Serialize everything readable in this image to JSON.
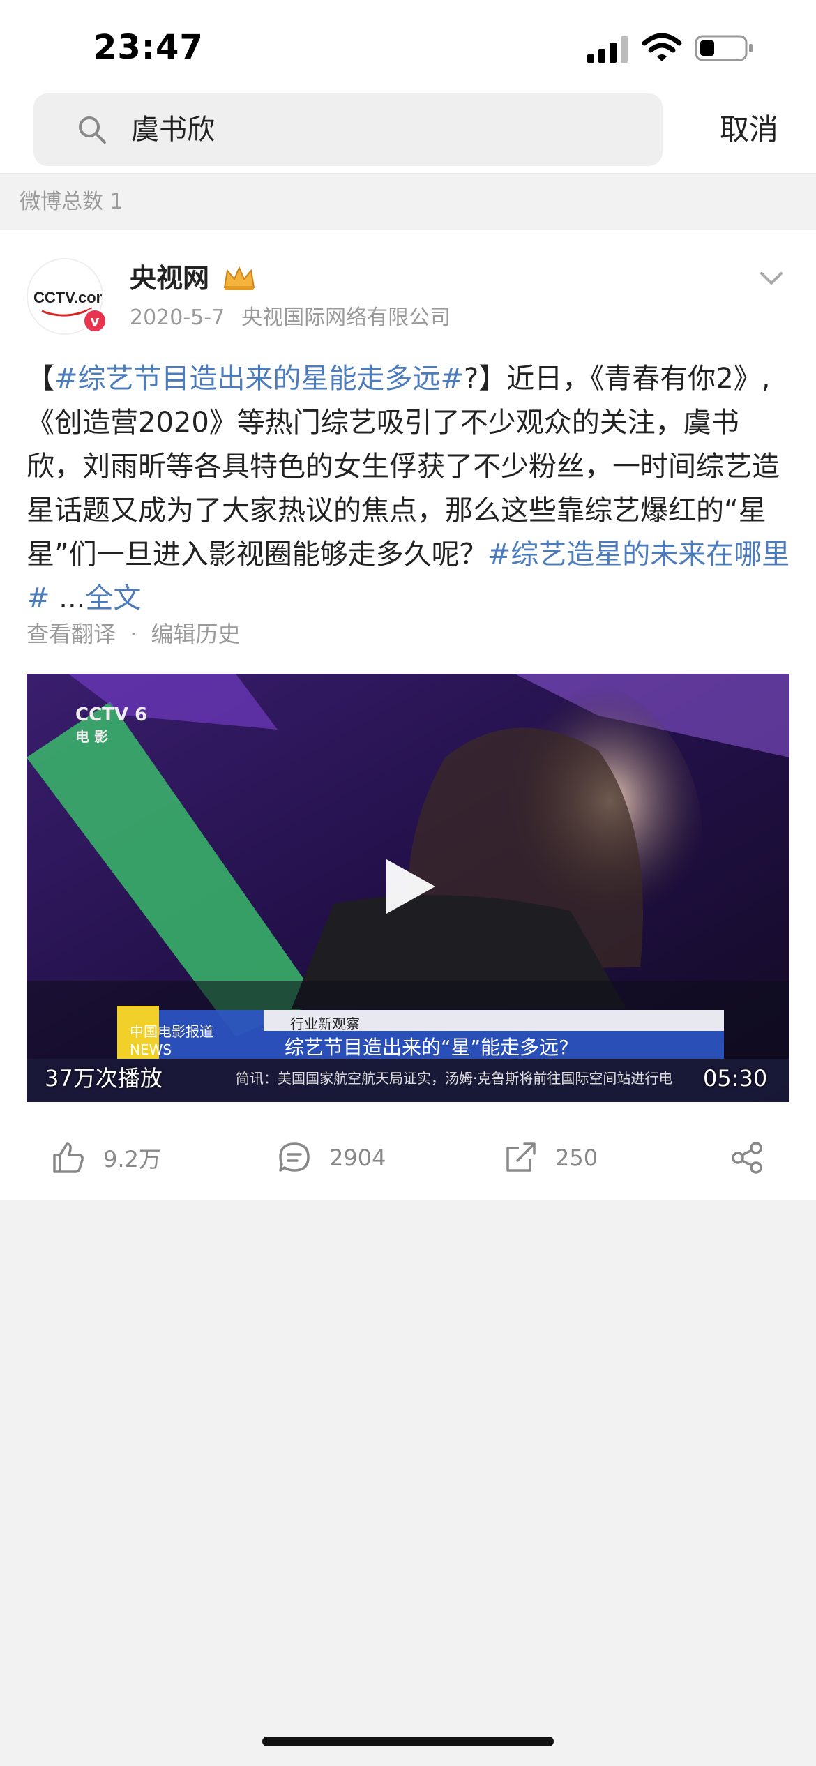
{
  "status_bar": {
    "time": "23:47"
  },
  "search": {
    "query": "虞书欣",
    "cancel_label": "取消"
  },
  "result_count": "微博总数 1",
  "post": {
    "author": "央视网",
    "date": "2020-5-7",
    "source": "央视国际网络有限公司",
    "avatar_text": "CCTV.com",
    "content": {
      "open_bracket": "【",
      "tag1": "#综艺节目造出来的星能走多远#",
      "part1": "?】近日，《青春有你2》,《创造营2020》等热门综艺吸引了不少观众的关注，虞书欣，刘雨昕等各具特色的女生俘获了不少粉丝，一时间综艺造星话题又成为了大家热议的焦点，那么这些靠综艺爆红的“星星”们一旦进入影视圈能够走多久呢？",
      "tag2": "#综艺造星的未来在哪里#",
      "ellipsis": " ...",
      "more": "全文"
    },
    "translate_label": "查看翻译",
    "separator": "·",
    "edit_history_label": "编辑历史",
    "video": {
      "play_count": "37万次播放",
      "duration": "05:30",
      "channel_logo": "CCTV 6",
      "channel_sub": "电 影",
      "overlay_small": "行业新观察",
      "overlay_title": "综艺节目造出来的“星”能走多远?",
      "ticker": "简讯：美国国家航空航天局证实，汤姆·克鲁斯将前往国际空间站进行电",
      "news_badge": "中国电影报道 NEWS"
    },
    "stats": {
      "likes": "9.2万",
      "comments": "2904",
      "reposts": "250"
    }
  },
  "colors": {
    "link": "#4c7cbb",
    "verified": "#e8344e"
  }
}
